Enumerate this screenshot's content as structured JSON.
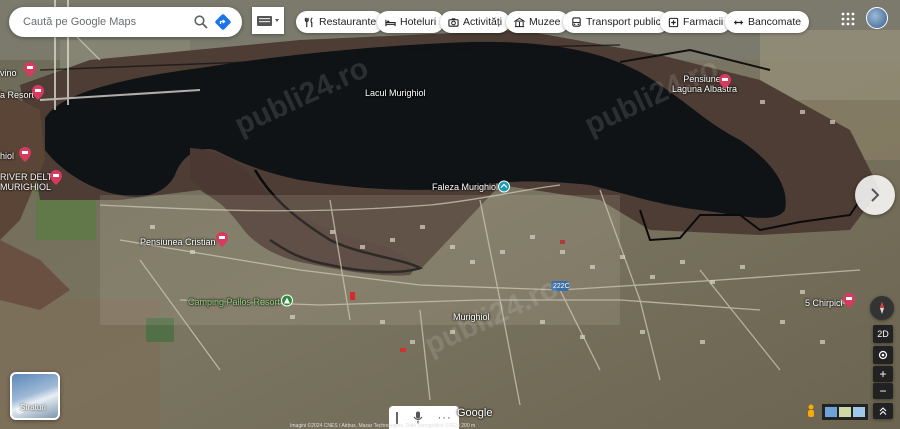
{
  "search": {
    "placeholder": "Caută pe Google Maps"
  },
  "filters": [
    {
      "label": "Restaurante",
      "icon": "fork-knife-icon"
    },
    {
      "label": "Hoteluri",
      "icon": "bed-icon"
    },
    {
      "label": "Activități",
      "icon": "camera-icon"
    },
    {
      "label": "Muzee",
      "icon": "museum-icon"
    },
    {
      "label": "Transport public",
      "icon": "bus-icon"
    },
    {
      "label": "Farmacii",
      "icon": "pharmacy-icon"
    },
    {
      "label": "Bancomate",
      "icon": "atm-icon"
    }
  ],
  "places": {
    "lake": "Lacul Murighiol",
    "faleza": "Faleza Murighiol",
    "pensiunea_laguna_line1": "Pensiunea",
    "pensiunea_laguna_line2": "Laguna Albastra",
    "pensiunea_cristian": "Pensiunea Cristian",
    "camping": "Camping Pallos Resort",
    "town": "Murighiol",
    "chirpici": "5 Chirpici",
    "river_delta_line1": "RIVER DELTA",
    "river_delta_line2": "MURIGHIOL",
    "resort_left": "a Resort",
    "vino": "vino",
    "murighiol_left": "hiol",
    "road": "222C"
  },
  "watermark": "publi24.ro",
  "layers": {
    "label": "Straturi"
  },
  "controls": {
    "mode_2d": "2D",
    "zoom_in": "+",
    "zoom_out": "−"
  },
  "bottom": {
    "google": "Google",
    "attribution": "Imagini ©2024 CNES / Airbus, Maxar Technologies, Date cartografice ©2024  200 m"
  },
  "colors": {
    "water": "#101418",
    "land": "#6f6c55",
    "reeds": "#4a3a34",
    "pin": "#d63a5e"
  }
}
